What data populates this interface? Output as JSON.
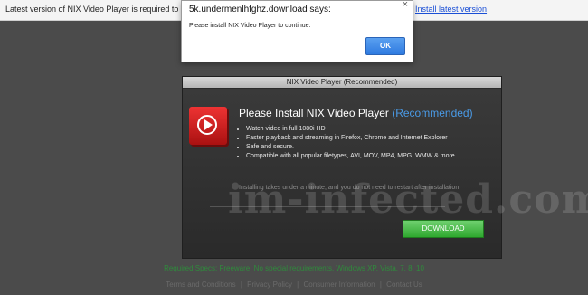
{
  "topbar": {
    "message": "Latest version of NIX Video Player is required to encode",
    "link": "Install latest version"
  },
  "alert": {
    "title": "5k.undermenlhfghz.download says:",
    "message": "Please install NIX Video Player to continue.",
    "ok_label": "OK"
  },
  "panel": {
    "header": "NIX Video Player (Recommended)",
    "headline_main": "Please Install NIX Video Player",
    "headline_rec": "(Recommended)",
    "features": [
      "Watch video in full 1080i HD",
      "Faster playback and streaming in Firefox, Chrome and Internet Explorer",
      "Safe and secure.",
      "Compatible with all popular filetypes, AVI, MOV, MP4, MPG, WMW & more"
    ],
    "note": "Installing takes under a minute, and you do not need to restart after installation",
    "download_label": "DOWNLOAD"
  },
  "watermark": "im-infected.com",
  "specs": "Required Specs: Freeware, No special requirements, Windows XP, Vista, 7, 8, 10",
  "footer": {
    "links": [
      "Terms and Conditions",
      "Privacy Policy",
      "Consumer Information",
      "Contact Us"
    ]
  }
}
